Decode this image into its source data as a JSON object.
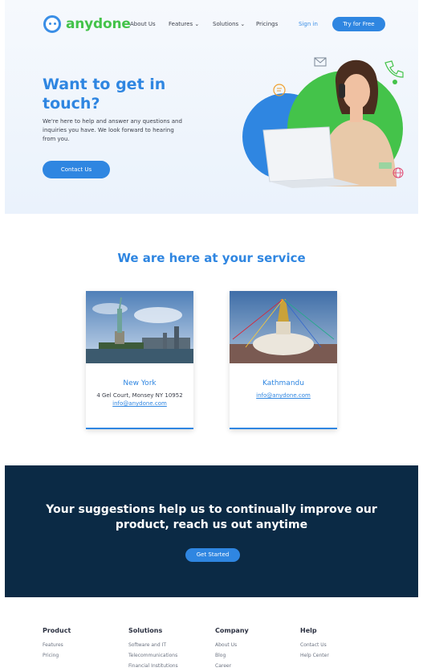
{
  "brand": {
    "name": "anydone",
    "primary": "#2f86e1",
    "green": "#44c34a",
    "dark": "#0b2a45"
  },
  "nav": {
    "about": "About Us",
    "features": "Features ⌄",
    "solutions": "Solutions ⌄",
    "pricings": "Pricings",
    "signin": "Sign in",
    "try": "Try for Free"
  },
  "hero": {
    "title": "Want to get in touch?",
    "description": "We're here to help and answer any questions and inquiries you have. We look forward to hearing from you.",
    "cta": "Contact Us"
  },
  "service": {
    "title": "We are here at your service",
    "cards": [
      {
        "city": "New York",
        "address": "4 Gel Court, Monsey NY 10952",
        "email": "info@anydone.com"
      },
      {
        "city": "Kathmandu",
        "email": "info@anydone.com"
      }
    ]
  },
  "cta": {
    "text": "Your suggestions help us to continually improve our product, reach us out anytime",
    "button": "Get Started"
  },
  "footer": {
    "columns": [
      {
        "title": "Product",
        "links": [
          "Features",
          "Pricing"
        ]
      },
      {
        "title": "Solutions",
        "links": [
          "Software and IT",
          "Telecommunications",
          "Financial Institutions"
        ]
      },
      {
        "title": "Company",
        "links": [
          "About Us",
          "Blog",
          "Career"
        ]
      },
      {
        "title": "Help",
        "links": [
          "Contact Us",
          "Help Center"
        ]
      }
    ]
  }
}
